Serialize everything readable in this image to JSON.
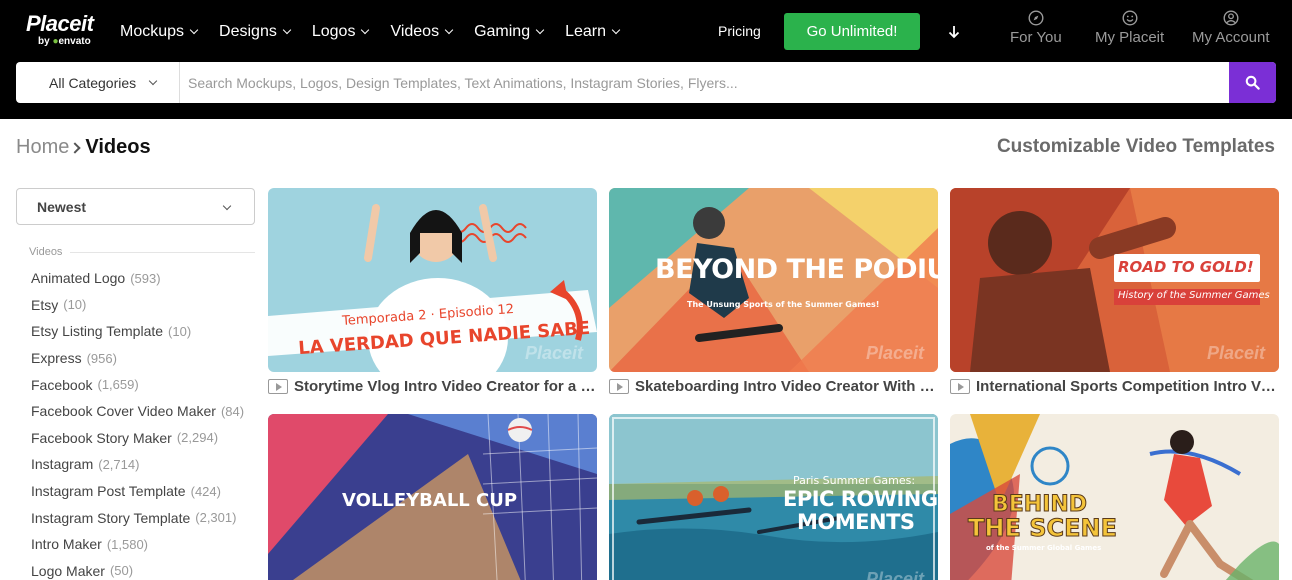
{
  "brand": {
    "name": "Placeit",
    "sub_prefix": "by ",
    "sub_mark": "envato"
  },
  "nav": [
    {
      "label": "Mockups"
    },
    {
      "label": "Designs"
    },
    {
      "label": "Logos"
    },
    {
      "label": "Videos"
    },
    {
      "label": "Gaming"
    },
    {
      "label": "Learn"
    }
  ],
  "header": {
    "pricing": "Pricing",
    "cta": "Go Unlimited!",
    "for_you": "For You",
    "my_placeit": "My Placeit",
    "my_account": "My Account"
  },
  "search": {
    "category": "All Categories",
    "placeholder": "Search Mockups, Logos, Design Templates, Text Animations, Instagram Stories, Flyers..."
  },
  "breadcrumb": {
    "home": "Home",
    "current": "Videos"
  },
  "page_heading": "Customizable Video Templates",
  "sidebar": {
    "sort": "Newest",
    "section": "Videos",
    "items": [
      {
        "label": "Animated Logo",
        "count": "(593)"
      },
      {
        "label": "Etsy",
        "count": "(10)"
      },
      {
        "label": "Etsy Listing Template",
        "count": "(10)"
      },
      {
        "label": "Express",
        "count": "(956)"
      },
      {
        "label": "Facebook",
        "count": "(1,659)"
      },
      {
        "label": "Facebook Cover Video Maker",
        "count": "(84)"
      },
      {
        "label": "Facebook Story Maker",
        "count": "(2,294)"
      },
      {
        "label": "Instagram",
        "count": "(2,714)"
      },
      {
        "label": "Instagram Post Template",
        "count": "(424)"
      },
      {
        "label": "Instagram Story Template",
        "count": "(2,301)"
      },
      {
        "label": "Intro Maker",
        "count": "(1,580)"
      },
      {
        "label": "Logo Maker",
        "count": "(50)"
      }
    ]
  },
  "cards": [
    {
      "title": "Storytime Vlog Intro Video Creator for a Spanish Series",
      "thumb_line1": "Temporada 2 · Episodio 12",
      "thumb_line2": "LA VERDAD QUE NADIE SABE",
      "watermark": "Placeit"
    },
    {
      "title": "Skateboarding Intro Video Creator With a Summer Games Theme",
      "thumb_line1": "BEYOND THE PODIUM",
      "thumb_line2": "The Unsung Sports of the Summer Games!",
      "watermark": "Placeit"
    },
    {
      "title": "International Sports Competition Intro Video Maker",
      "thumb_line1": "ROAD TO GOLD!",
      "thumb_line2": "History of the Summer Games",
      "watermark": "Placeit"
    },
    {
      "title": "",
      "thumb_line1": "VOLLEYBALL CUP",
      "thumb_line2": "",
      "watermark": ""
    },
    {
      "title": "",
      "thumb_line1": "Paris Summer Games:",
      "thumb_line2": "EPIC ROWING",
      "thumb_line3": "MOMENTS",
      "watermark": "Placeit"
    },
    {
      "title": "",
      "thumb_line1": "BEHIND",
      "thumb_line2": "THE SCENE",
      "thumb_line3": "of the Summer Global Games",
      "watermark": ""
    }
  ],
  "colors": {
    "header_bg": "#000000",
    "cta_green": "#2bb24c",
    "search_purple": "#7b2fd6"
  }
}
